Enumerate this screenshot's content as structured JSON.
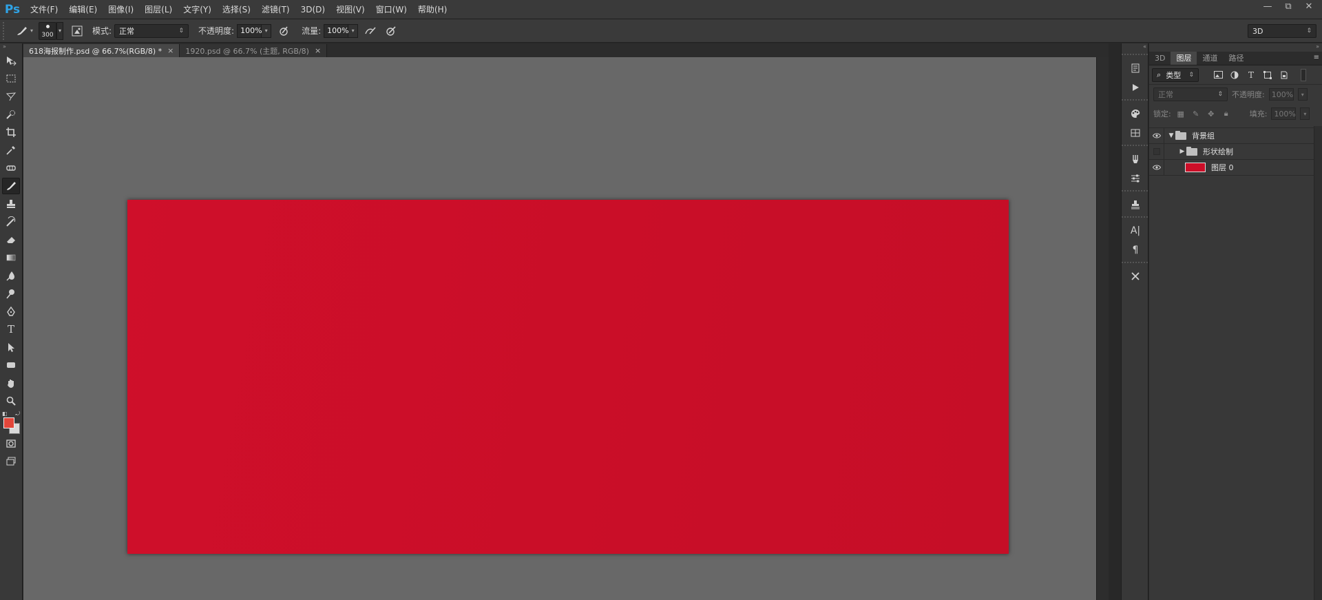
{
  "app": {
    "logo": "Ps"
  },
  "menu": [
    "文件(F)",
    "编辑(E)",
    "图像(I)",
    "图层(L)",
    "文字(Y)",
    "选择(S)",
    "滤镜(T)",
    "3D(D)",
    "视图(V)",
    "窗口(W)",
    "帮助(H)"
  ],
  "window_controls": {
    "minimize": "—",
    "restore": "⧉",
    "close": "✕"
  },
  "options": {
    "brush_size": "300",
    "mode_label": "模式:",
    "mode_value": "正常",
    "opacity_label": "不透明度:",
    "opacity_value": "100%",
    "flow_label": "流量:",
    "flow_value": "100%",
    "workspace": "3D"
  },
  "tools": [
    "move-tool",
    "marquee-tool",
    "lasso-tool",
    "quick-select-tool",
    "crop-tool",
    "eyedropper-tool",
    "healing-tool",
    "brush-tool",
    "stamp-tool",
    "history-brush-tool",
    "eraser-tool",
    "gradient-tool",
    "blur-tool",
    "dodge-tool",
    "pen-tool",
    "type-tool",
    "path-select-tool",
    "shape-tool",
    "hand-tool",
    "zoom-tool"
  ],
  "colors": {
    "foreground": "#e2463a",
    "background": "#d9d9d9",
    "canvas_fill": "#cc0e28"
  },
  "documents": [
    {
      "title": "618海报制作.psd @ 66.7%(RGB/8) *",
      "close": "×",
      "active": true
    },
    {
      "title": "1920.psd @ 66.7% (主题, RGB/8)",
      "close": "×",
      "active": false
    }
  ],
  "dock_icons": [
    "history-icon",
    "actions-icon",
    "swatches-icon",
    "adjustments-icon",
    "brushes-icon",
    "properties-icon",
    "clone-source-icon",
    "character-icon",
    "paragraph-icon",
    "tool-presets-icon"
  ],
  "panel": {
    "tabs": [
      "3D",
      "图层",
      "通道",
      "路径"
    ],
    "active_tab": "图层",
    "filter_kind": "类型",
    "blend_mode": "正常",
    "opacity_label": "不透明度:",
    "opacity_value": "100%",
    "lock_label": "锁定:",
    "fill_label": "填充:",
    "fill_value": "100%",
    "layers": [
      {
        "name": "背景组",
        "type": "group",
        "expanded": true,
        "visible": true,
        "indent": 0
      },
      {
        "name": "形状绘制",
        "type": "group",
        "expanded": false,
        "visible": false,
        "indent": 1
      },
      {
        "name": "图层 0",
        "type": "layer",
        "visible": true,
        "indent": 1
      }
    ]
  }
}
